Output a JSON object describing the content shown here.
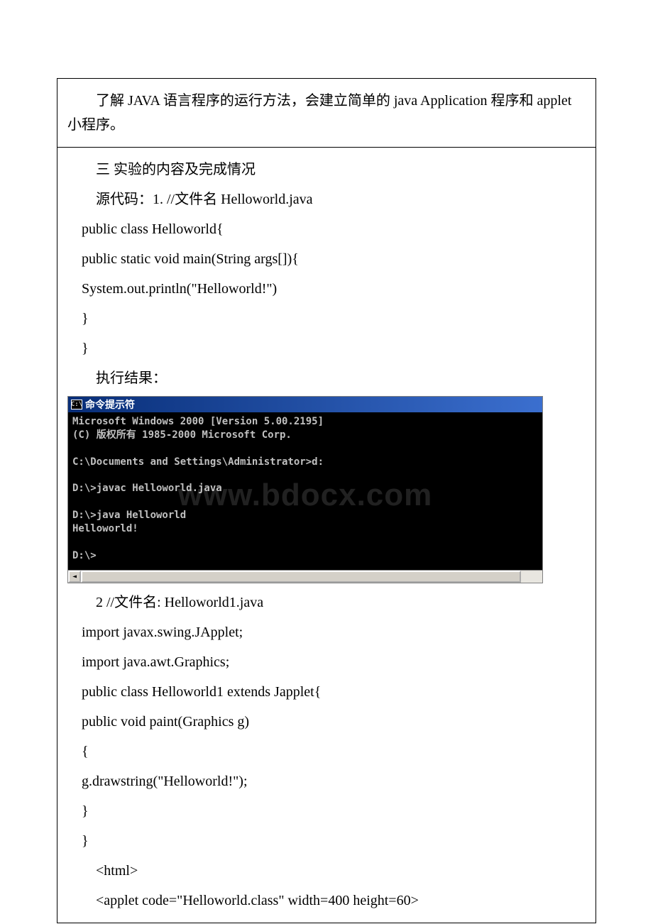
{
  "row1": {
    "p1": "了解 JAVA 语言程序的运行方法，会建立简单的 java Application 程序和 applet 小程序。"
  },
  "row2": {
    "heading": "三 实验的内容及完成情况",
    "source_label": "源代码：1. //文件名 Helloworld.java",
    "code1_l1": " public class Helloworld{",
    "code1_l2": " public static void main(String args[]){",
    "code1_l3": " System.out.println(\"Helloworld!\")",
    "code1_l4": " }",
    "code1_l5": " }",
    "result_label": "执行结果：",
    "console": {
      "title": "命令提示符",
      "icon_text": "C:\\",
      "l1": "Microsoft Windows 2000 [Version 5.00.2195]",
      "l2": "(C) 版权所有 1985-2000 Microsoft Corp.",
      "l3": "",
      "l4": "C:\\Documents and Settings\\Administrator>d:",
      "l5": "",
      "l6": "D:\\>javac Helloworld.java",
      "l7": "",
      "l8": "D:\\>java Helloworld",
      "l9": "Helloworld!",
      "l10": "",
      "l11": "D:\\>",
      "watermark": "www.bdocx.com",
      "left_arrow": "◄"
    },
    "src2_label": "2 //文件名: Helloworld1.java",
    "code2_l1": " import javax.swing.JApplet;",
    "code2_l2": " import java.awt.Graphics;",
    "code2_l3": " public class Helloworld1 extends Japplet{",
    "code2_l4": " public void paint(Graphics g)",
    "code2_l5": " {",
    "code2_l6": " g.drawstring(\"Helloworld!\");",
    "code2_l7": " }",
    "code2_l8": " }",
    "html_l1": "<html>",
    "html_l2": "<applet code=\"Helloworld.class\" width=400 height=60>"
  }
}
